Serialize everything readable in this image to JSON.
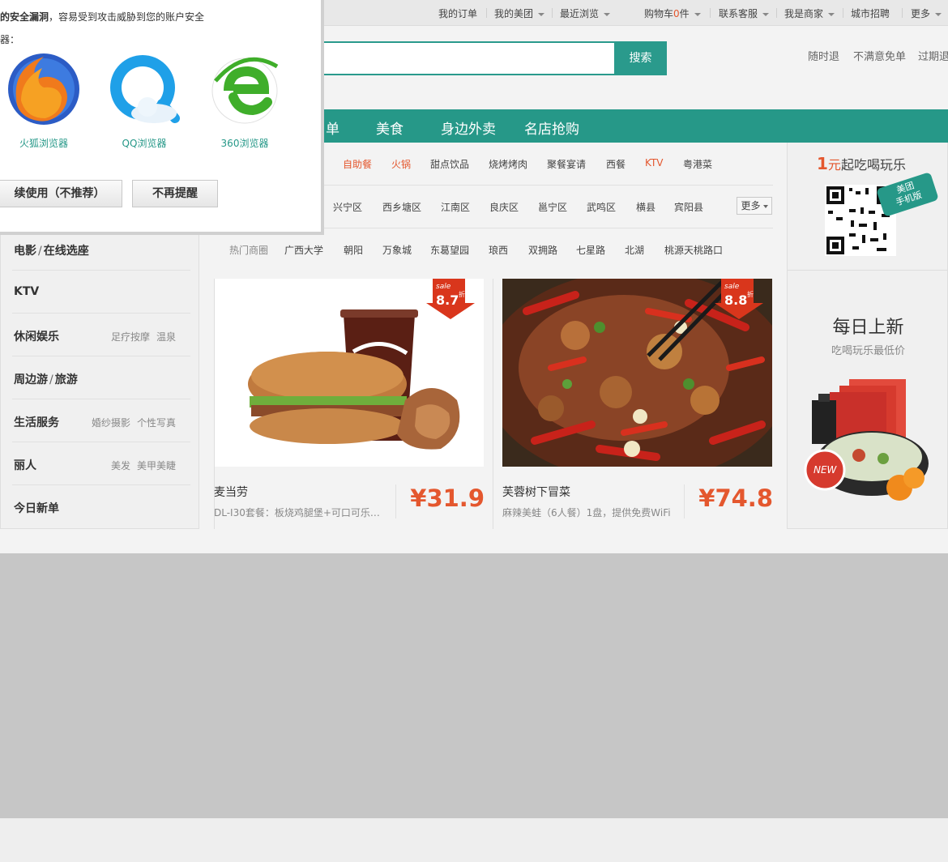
{
  "topbar": {
    "my_orders": "我的订单",
    "my_meituan": "我的美团",
    "recent": "最近浏览",
    "cart_prefix": "购物车",
    "cart_count": "0",
    "cart_suffix": "件",
    "service": "联系客服",
    "merchant": "我是商家",
    "jobs": "城市招聘",
    "more": "更多"
  },
  "search": {
    "button": "搜索"
  },
  "promises": [
    "随时退",
    "不满意免单",
    "过期退"
  ],
  "nav": [
    "单",
    "美食",
    "身边外卖",
    "名店抢购"
  ],
  "filters": {
    "row1": [
      "自助餐",
      "火锅",
      "甜点饮品",
      "烧烤烤肉",
      "聚餐宴请",
      "西餐",
      "KTV",
      "粤港菜"
    ],
    "row2": [
      "兴宁区",
      "西乡塘区",
      "江南区",
      "良庆区",
      "邕宁区",
      "武鸣区",
      "横县",
      "宾阳县"
    ],
    "row2_more": "更多",
    "row3_label": "热门商圈",
    "row3": [
      "广西大学",
      "朝阳",
      "万象城",
      "东葛望园",
      "琅西",
      "双拥路",
      "七星路",
      "北湖",
      "桃源天桃路口"
    ]
  },
  "sidebar": [
    {
      "main": "电影",
      "main2": "在线选座",
      "subs": []
    },
    {
      "main": "KTV",
      "main2": "",
      "subs": []
    },
    {
      "main": "休闲娱乐",
      "main2": "",
      "subs": [
        "足疗按摩",
        "温泉"
      ]
    },
    {
      "main": "周边游",
      "main2": "旅游",
      "subs": []
    },
    {
      "main": "生活服务",
      "main2": "",
      "subs": [
        "婚纱摄影",
        "个性写真"
      ]
    },
    {
      "main": "丽人",
      "main2": "",
      "subs": [
        "美发",
        "美甲美睫"
      ]
    },
    {
      "main": "今日新单",
      "main2": "",
      "subs": []
    }
  ],
  "deals": [
    {
      "name": "麦当劳",
      "desc": "DL-I30套餐：板烧鸡腿堡+可口可乐（…",
      "price": "¥31.9",
      "discount": "8.7",
      "sale": "sale",
      "zhe": "折"
    },
    {
      "name": "芙蓉树下冒菜",
      "desc": "麻辣美蛙（6人餐）1盘，提供免费WiFi",
      "price": "¥74.8",
      "discount": "8.8",
      "sale": "sale",
      "zhe": "折"
    }
  ],
  "right": {
    "promo_num": "1",
    "promo_unit": "元",
    "promo_text": "起吃喝玩乐",
    "app_tag_line1": "美团",
    "app_tag_line2": "手机版",
    "daily_title": "每日上新",
    "daily_sub": "吃喝玩乐最低价",
    "new_badge": "NEW"
  },
  "popup": {
    "line1_bold": "的安全漏洞",
    "line1_rest": "，容易受到攻击威胁到您的账户安全",
    "line2": "器：",
    "browsers": [
      "火狐浏览器",
      "QQ浏览器",
      "360浏览器"
    ],
    "continue_btn": "续使用（不推荐）",
    "dismiss_btn": "不再提醒"
  },
  "colors": {
    "brand": "#269888",
    "accent": "#e4572e"
  }
}
